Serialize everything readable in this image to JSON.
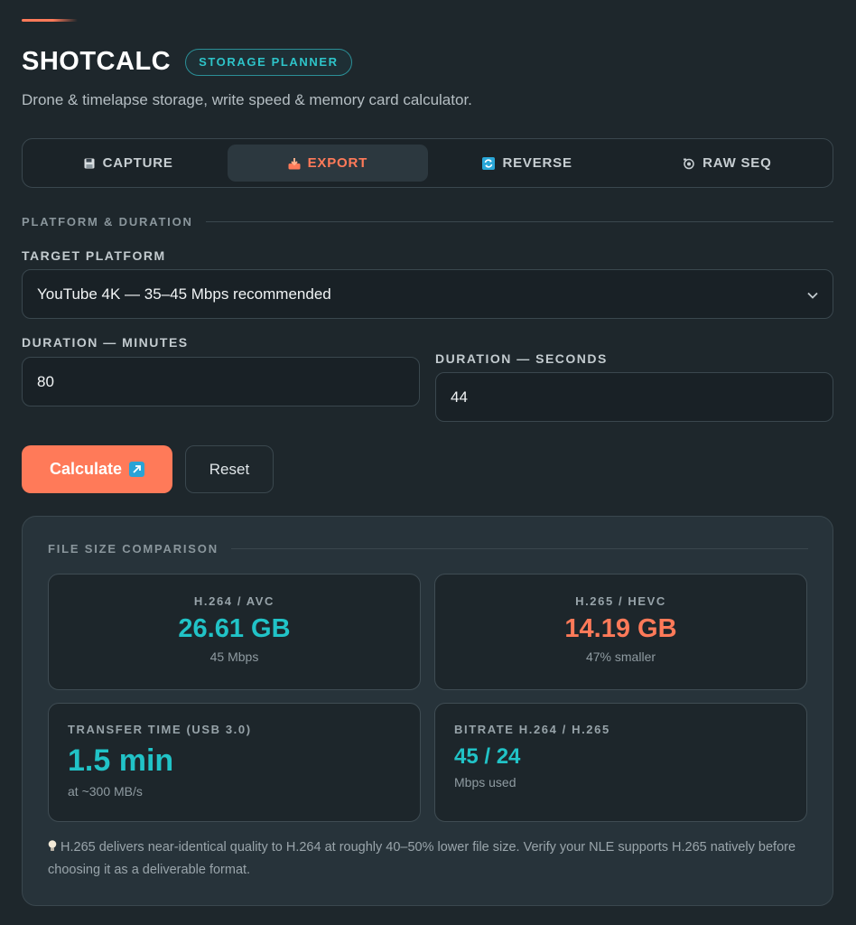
{
  "app": {
    "title": "SHOTCALC",
    "badge": "STORAGE PLANNER",
    "subtitle": "Drone & timelapse storage, write speed & memory card calculator."
  },
  "tabs": [
    {
      "label": "CAPTURE",
      "icon": "save-icon",
      "active": false
    },
    {
      "label": "EXPORT",
      "icon": "export-icon",
      "active": true
    },
    {
      "label": "REVERSE",
      "icon": "reverse-icon",
      "active": false
    },
    {
      "label": "RAW SEQ",
      "icon": "camera-icon",
      "active": false
    }
  ],
  "form": {
    "section_label": "PLATFORM & DURATION",
    "platform_label": "TARGET PLATFORM",
    "platform_value": "YouTube 4K — 35–45 Mbps recommended",
    "minutes_label": "DURATION — MINUTES",
    "minutes_value": "80",
    "seconds_label": "DURATION — SECONDS",
    "seconds_value": "44"
  },
  "actions": {
    "calculate": "Calculate",
    "reset": "Reset"
  },
  "results": {
    "section_label": "FILE SIZE COMPARISON",
    "h264": {
      "label": "H.264 / AVC",
      "value": "26.61 GB",
      "sub": "45 Mbps"
    },
    "h265": {
      "label": "H.265 / HEVC",
      "value": "14.19 GB",
      "sub": "47% smaller"
    },
    "transfer": {
      "label": "TRANSFER TIME (USB 3.0)",
      "value": "1.5 min",
      "sub": "at ~300 MB/s"
    },
    "bitrate": {
      "label": "BITRATE H.264 / H.265",
      "value": "45 / 24",
      "sub": "Mbps used"
    },
    "tip": "H.265 delivers near-identical quality to H.264 at roughly 40–50% lower file size. Verify your NLE supports H.265 natively before choosing it as a deliverable format."
  },
  "colors": {
    "accent": "#ff7a59",
    "teal": "#21c3c7",
    "background": "#1e272c"
  }
}
